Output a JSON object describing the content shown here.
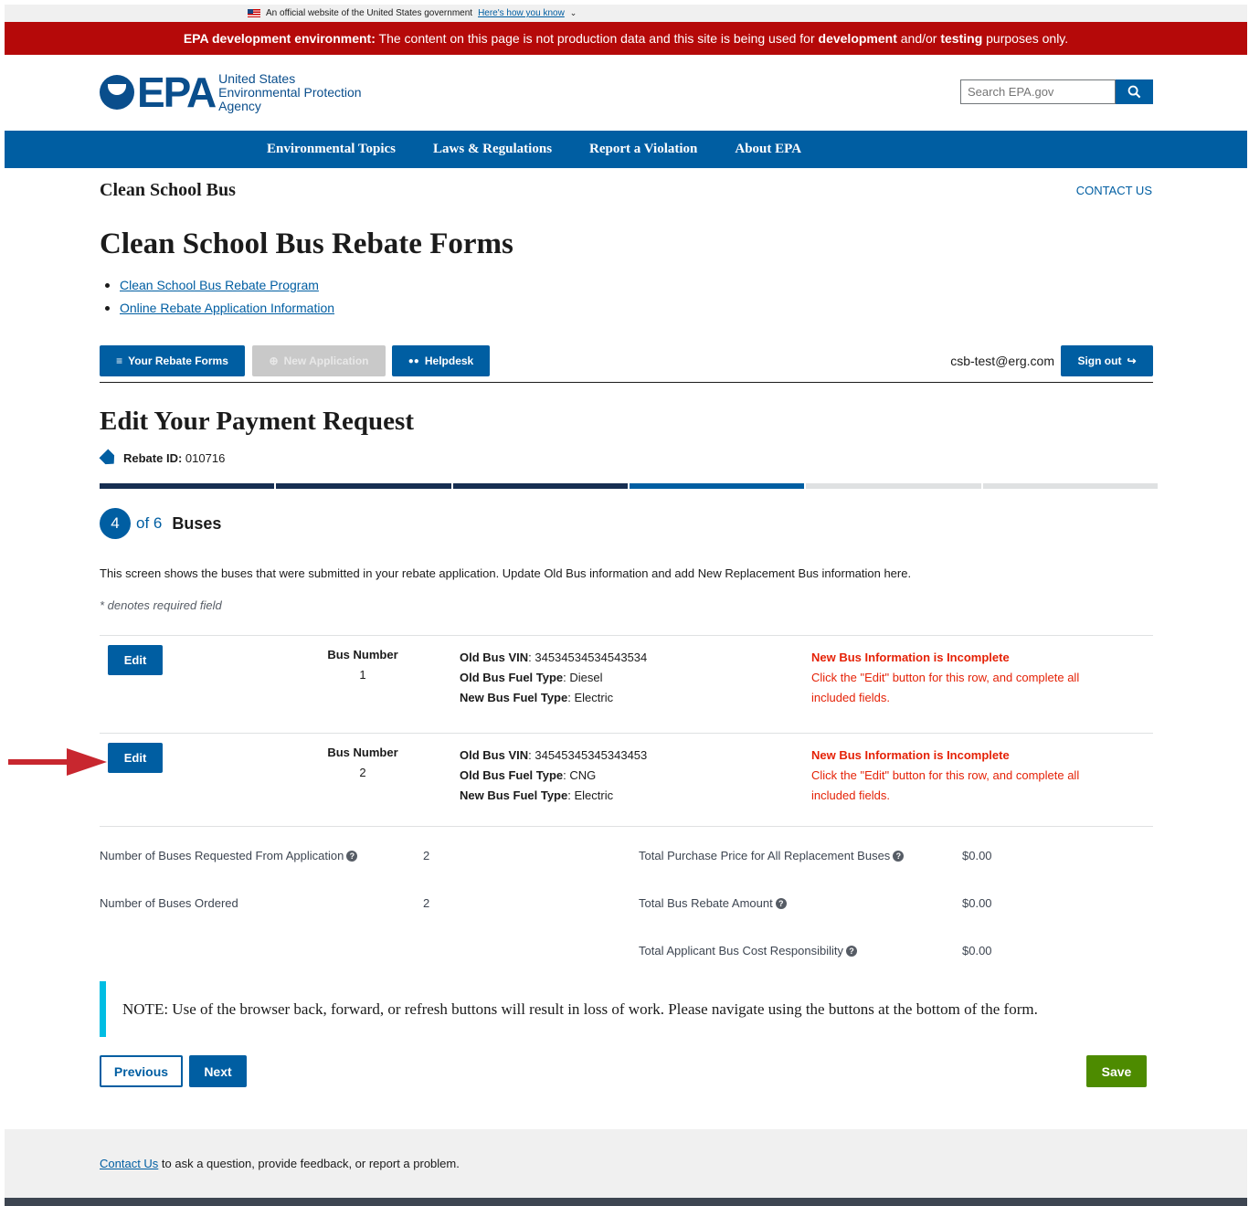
{
  "gov_banner": {
    "text": "An official website of the United States government",
    "link": "Here's how you know"
  },
  "dev_banner": {
    "label": "EPA development environment:",
    "text_1": " The content on this page is not production data and this site is being used for ",
    "bold_1": "development",
    "text_2": " and/or ",
    "bold_2": "testing",
    "text_3": " purposes only."
  },
  "header": {
    "logo_text": "EPA",
    "agency_line_1": "United States",
    "agency_line_2": "Environmental Protection",
    "agency_line_3": "Agency",
    "search_placeholder": "Search EPA.gov"
  },
  "nav": [
    "Environmental Topics",
    "Laws & Regulations",
    "Report a Violation",
    "About EPA"
  ],
  "site_title": "Clean School Bus",
  "contact_us": "CONTACT US",
  "page_title": "Clean School Bus Rebate Forms",
  "links": [
    "Clean School Bus Rebate Program",
    "Online Rebate Application Information"
  ],
  "toolbar": {
    "your_forms": "Your Rebate Forms",
    "new_application": "New Application",
    "helpdesk": "Helpdesk",
    "user_email": "csb-test@erg.com",
    "sign_out": "Sign out"
  },
  "form": {
    "title": "Edit Your Payment Request",
    "rebate_label": "Rebate ID:",
    "rebate_id": "010716",
    "step_current": "4",
    "step_total": "of 6",
    "step_name": "Buses",
    "progress": {
      "completed": 3,
      "current": 4,
      "total": 6
    },
    "intro": "This screen shows the buses that were submitted in your rebate application. Update Old Bus information and add New Replacement Bus information here.",
    "required_note": "* denotes required field"
  },
  "buses": [
    {
      "edit_label": "Edit",
      "number_label": "Bus Number",
      "number": "1",
      "vin_label": "Old Bus VIN",
      "vin": "34534534534543534",
      "old_fuel_label": "Old Bus Fuel Type",
      "old_fuel": "Diesel",
      "new_fuel_label": "New Bus Fuel Type",
      "new_fuel": "Electric",
      "status_title": "New Bus Information is Incomplete",
      "status_text": "Click the \"Edit\" button for this row, and complete all included fields."
    },
    {
      "edit_label": "Edit",
      "number_label": "Bus Number",
      "number": "2",
      "vin_label": "Old Bus VIN",
      "vin": "34545345345343453",
      "old_fuel_label": "Old Bus Fuel Type",
      "old_fuel": "CNG",
      "new_fuel_label": "New Bus Fuel Type",
      "new_fuel": "Electric",
      "status_title": "New Bus Information is Incomplete",
      "status_text": "Click the \"Edit\" button for this row, and complete all included fields."
    }
  ],
  "summary": {
    "requested_label": "Number of Buses Requested From Application",
    "requested_value": "2",
    "ordered_label": "Number of Buses Ordered",
    "ordered_value": "2",
    "total_price_label": "Total Purchase Price for All Replacement Buses",
    "total_price_value": "$0.00",
    "total_rebate_label": "Total Bus Rebate Amount",
    "total_rebate_value": "$0.00",
    "applicant_cost_label": "Total Applicant Bus Cost Responsibility",
    "applicant_cost_value": "$0.00"
  },
  "note": "NOTE: Use of the browser back, forward, or refresh buttons will result in loss of work. Please navigate using the buttons at the bottom of the form.",
  "buttons": {
    "previous": "Previous",
    "next": "Next",
    "save": "Save"
  },
  "footer": {
    "link": "Contact Us",
    "text": " to ask a question, provide feedback, or report a problem."
  },
  "colors": {
    "primary": "#005ea2",
    "dev_banner": "#b50909",
    "error": "#e52207",
    "save": "#4d8b00",
    "note_border": "#00bde3",
    "progress_done": "#162e51",
    "progress_current": "#005ea2",
    "progress_todo": "#dfe1e2"
  },
  "icons": {
    "search": "search-icon",
    "list": "list-icon",
    "plus": "plus-circle-icon",
    "people": "people-icon",
    "signout": "sign-out-icon",
    "tag": "tag-icon",
    "help": "question-circle-icon",
    "arrow": "red-arrow-annotation"
  }
}
